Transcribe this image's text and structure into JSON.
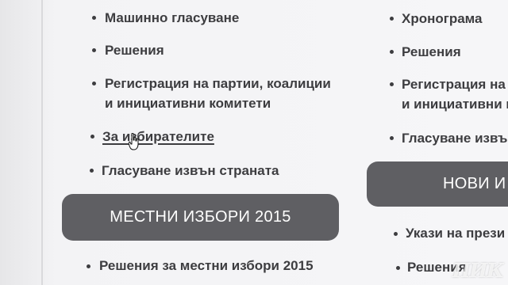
{
  "left_column": {
    "items": [
      {
        "label": "Машинно гласуване"
      },
      {
        "label": "Решения"
      },
      {
        "label_line1": "Регистрация на партии, коалиции",
        "label_line2": "и инициативни комитети"
      },
      {
        "label": "За избирателите"
      },
      {
        "label": "Гласуване извън страната"
      }
    ],
    "section_header": "МЕСТНИ ИЗБОРИ 2015",
    "section_items": [
      {
        "label": "Решения за местни избори 2015"
      }
    ]
  },
  "right_column": {
    "items": [
      {
        "label": "Хронограма"
      },
      {
        "label": "Решения"
      },
      {
        "label_line1": "Регистрация на па",
        "label_line2": "и инициативни ком"
      },
      {
        "label": "Гласуване извъ"
      }
    ],
    "section_header": "НОВИ И",
    "section_items": [
      {
        "label": "Укази на прези"
      },
      {
        "label": "Решения"
      }
    ]
  },
  "watermark": "ПИК",
  "cursor_icon": "hand-pointer-icon",
  "colors": {
    "text": "#3d3d40",
    "header_bg": "#5f5f63",
    "header_text": "#ffffff",
    "page_bg": "#f6f6f8"
  }
}
